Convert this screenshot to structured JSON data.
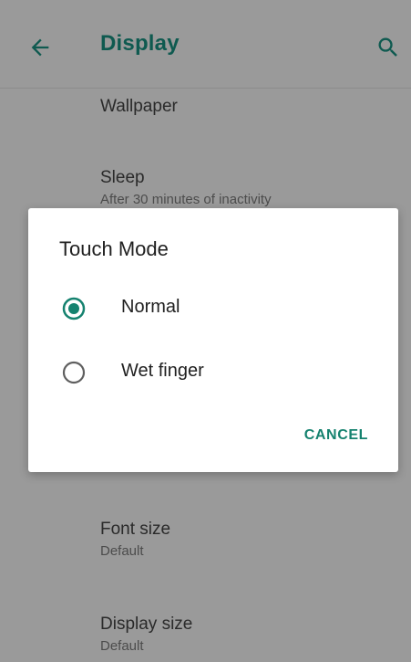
{
  "appbar": {
    "title": "Display",
    "back_icon": "arrow-left-icon",
    "search_icon": "search-icon"
  },
  "list": {
    "wallpaper_label": "Wallpaper",
    "sleep_label": "Sleep",
    "sleep_value": "After 30 minutes of inactivity",
    "font_size_label": "Font size",
    "font_size_value": "Default",
    "display_size_label": "Display size",
    "display_size_value": "Default"
  },
  "dialog": {
    "title": "Touch Mode",
    "options": [
      {
        "label": "Normal",
        "selected": true
      },
      {
        "label": "Wet finger",
        "selected": false
      }
    ],
    "cancel_label": "CANCEL"
  },
  "colors": {
    "accent": "#15826f",
    "title_dimmed": "#0f5a50",
    "scrim_background": "#9a9a9a"
  }
}
